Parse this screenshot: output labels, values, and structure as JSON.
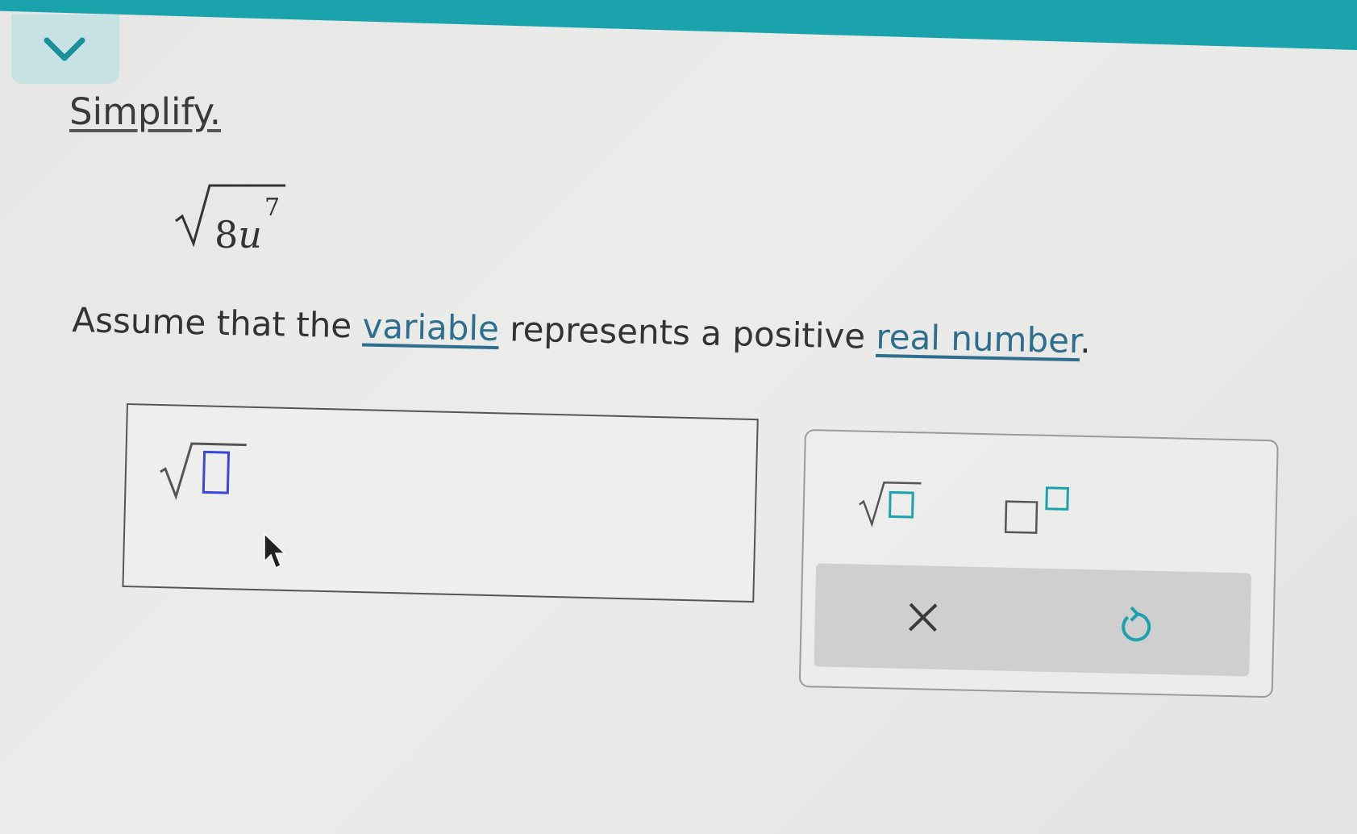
{
  "header": {
    "accent": "#1aa3ad"
  },
  "question": {
    "instruction": "Simplify.",
    "expression": {
      "coefficient": "8",
      "variable": "u",
      "exponent": "7"
    },
    "assume_pre": "Assume that the ",
    "assume_link1": "variable",
    "assume_mid": " represents a positive ",
    "assume_link2": "real number",
    "assume_end": "."
  },
  "icons": {
    "collapse": "chevron-down-icon",
    "sqrt_template": "square-root-icon",
    "exponent_template": "exponent-icon",
    "clear": "close-icon",
    "undo": "undo-icon"
  },
  "colors": {
    "placeholder": "#3b46e0",
    "link": "#2e6f8e",
    "keypad_icon": "#1aa3ad"
  }
}
